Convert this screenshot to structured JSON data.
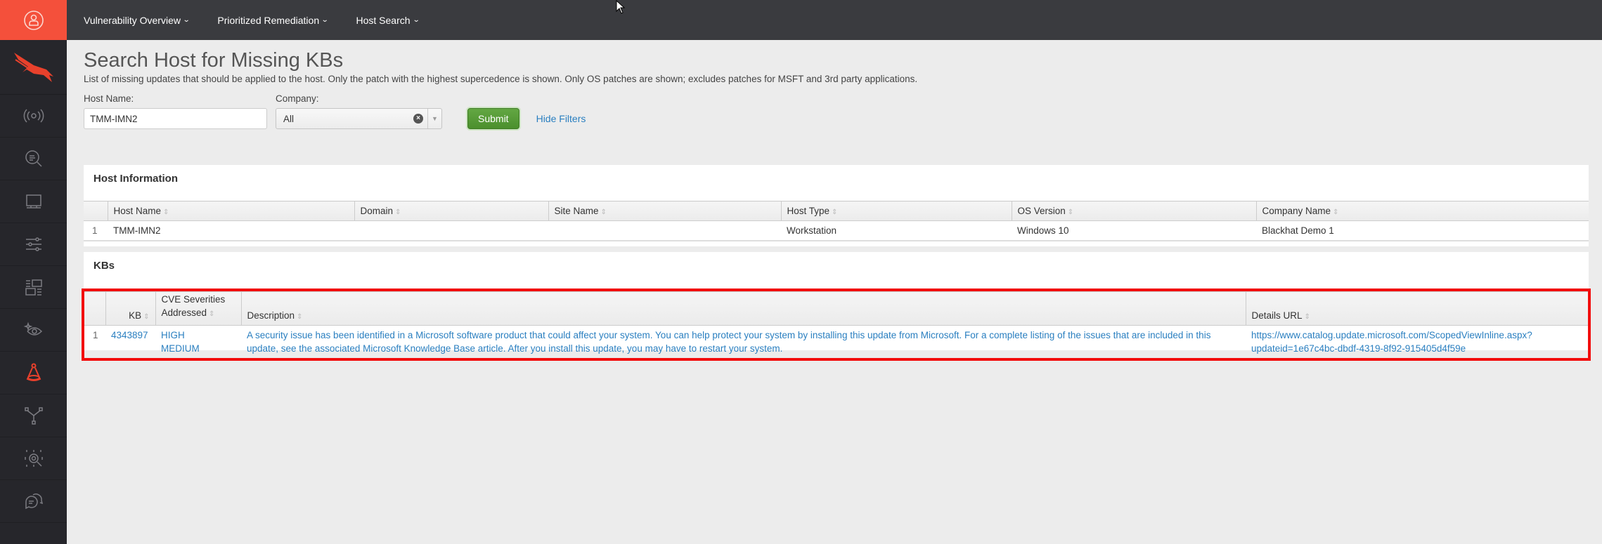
{
  "sidebar": {
    "user_icon": "user-circle-icon",
    "logo": "falcon-logo",
    "items": [
      {
        "name": "sensor",
        "icon": "broadcast-icon",
        "active": false
      },
      {
        "name": "investigate",
        "icon": "search-log-icon",
        "active": false
      },
      {
        "name": "hosts",
        "icon": "monitor-icon",
        "active": false
      },
      {
        "name": "configuration",
        "icon": "sliders-icon",
        "active": false
      },
      {
        "name": "dashboards",
        "icon": "layout-icon",
        "active": false
      },
      {
        "name": "discover",
        "icon": "eye-sparkle-icon",
        "active": false
      },
      {
        "name": "spotlight",
        "icon": "flask-icon",
        "active": true
      },
      {
        "name": "workflow",
        "icon": "network-nodes-icon",
        "active": false
      },
      {
        "name": "intelligence",
        "icon": "target-search-icon",
        "active": false
      },
      {
        "name": "support",
        "icon": "chat-bubbles-icon",
        "active": false
      }
    ],
    "accent_color": "#f4503b"
  },
  "topnav": {
    "items": [
      {
        "label": "Vulnerability Overview"
      },
      {
        "label": "Prioritized Remediation"
      },
      {
        "label": "Host Search"
      }
    ]
  },
  "page": {
    "title": "Search Host for Missing KBs",
    "subtitle": "List of missing updates that should be applied to the host. Only the patch with the highest supercedence is shown. Only OS patches are shown; excludes patches for MSFT and 3rd party applications."
  },
  "filters": {
    "host_name_label": "Host Name:",
    "host_name_value": "TMM-IMN2",
    "company_label": "Company:",
    "company_value": "All",
    "submit_label": "Submit",
    "hide_filters_label": "Hide Filters"
  },
  "host_info": {
    "title": "Host Information",
    "columns": [
      "Host Name",
      "Domain",
      "Site Name",
      "Host Type",
      "OS Version",
      "Company Name"
    ],
    "rows": [
      {
        "num": "1",
        "host_name": "TMM-IMN2",
        "domain": "",
        "site_name": "",
        "host_type": "Workstation",
        "os_version": "Windows 10",
        "company_name": "Blackhat Demo 1"
      }
    ]
  },
  "kbs": {
    "title": "KBs",
    "columns": {
      "kb": "KB",
      "cve_line1": "CVE Severities",
      "cve_line2": "Addressed",
      "description": "Description",
      "details_url": "Details URL"
    },
    "rows": [
      {
        "num": "1",
        "kb": "4343897",
        "severity_1": "HIGH",
        "severity_2": "MEDIUM",
        "description": "A security issue has been identified in a Microsoft software product that could affect your system. You can help protect your system by installing this update from Microsoft. For a complete listing of the issues that are included in this update, see the associated Microsoft Knowledge Base article. After you install this update, you may have to restart your system.",
        "url_line1": "https://www.catalog.update.microsoft.com/ScopedViewInline.aspx?",
        "url_line2": "updateid=1e67c4bc-dbdf-4319-8f92-915405d4f59e"
      }
    ],
    "highlight_color": "#f20d0d"
  },
  "icons": {
    "sort": "⇕",
    "chevron": "⌄",
    "clear": "×",
    "dropdown_arrow": "▼"
  }
}
